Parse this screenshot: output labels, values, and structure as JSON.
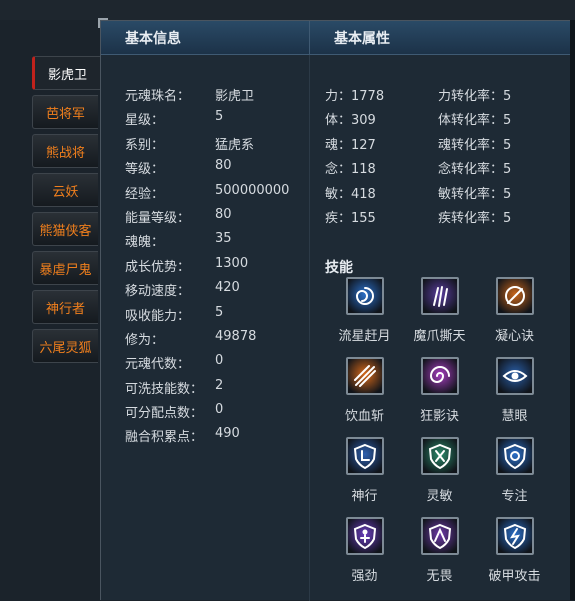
{
  "tabs": [
    "影虎卫",
    "芭将军",
    "熊战将",
    "云妖",
    "熊猫侠客",
    "暴虐尸鬼",
    "神行者",
    "六尾灵狐"
  ],
  "active_tab": 0,
  "headers": {
    "basic_info": "基本信息",
    "basic_attr": "基本属性"
  },
  "info_rows": [
    {
      "k": "元魂珠名：",
      "v": "影虎卫"
    },
    {
      "k": "星级：",
      "v": "5"
    },
    {
      "k": "系别：",
      "v": "猛虎系"
    },
    {
      "k": "等级：",
      "v": "80"
    },
    {
      "k": "经验：",
      "v": "500000000"
    },
    {
      "k": "能量等级：",
      "v": "80"
    },
    {
      "k": "魂魄：",
      "v": "35"
    },
    {
      "k": "成长优势：",
      "v": "1300"
    },
    {
      "k": "移动速度：",
      "v": "420"
    },
    {
      "k": "吸收能力：",
      "v": "5"
    },
    {
      "k": "修为：",
      "v": "49878"
    },
    {
      "k": "元魂代数：",
      "v": "0"
    },
    {
      "k": "可洗技能数：",
      "v": "2"
    },
    {
      "k": "可分配点数：",
      "v": "0"
    },
    {
      "k": "融合积累点：",
      "v": "490"
    }
  ],
  "attributes": [
    {
      "a": "力：1778",
      "b": "力转化率：5"
    },
    {
      "a": "体：309",
      "b": "体转化率：5"
    },
    {
      "a": "魂：127",
      "b": "魂转化率：5"
    },
    {
      "a": "念：118",
      "b": "念转化率：5"
    },
    {
      "a": "敏：418",
      "b": "敏转化率：5"
    },
    {
      "a": "疾：155",
      "b": "疾转化率：5"
    }
  ],
  "skills_title": "技能",
  "skills": [
    {
      "label": "流星赶月",
      "icon": "swirl-icon",
      "color": "#2a6fc9"
    },
    {
      "label": "魔爪撕天",
      "icon": "claw-icon",
      "color": "#5a3d9e"
    },
    {
      "label": "凝心诀",
      "icon": "flame-ring-icon",
      "color": "#c8651a"
    },
    {
      "label": "饮血斩",
      "icon": "slash-icon",
      "color": "#d86a1a"
    },
    {
      "label": "狂影诀",
      "icon": "spiral-icon",
      "color": "#a43dbd"
    },
    {
      "label": "慧眼",
      "icon": "eye-icon",
      "color": "#2a5fa8"
    },
    {
      "label": "神行",
      "icon": "shield-boot-icon",
      "color": "#2e5fae"
    },
    {
      "label": "灵敏",
      "icon": "shield-rune-icon",
      "color": "#2a8a6a"
    },
    {
      "label": "专注",
      "icon": "shield-target-icon",
      "color": "#2a6fc9"
    },
    {
      "label": "强劲",
      "icon": "shield-figure-icon",
      "color": "#6a3dbd"
    },
    {
      "label": "无畏",
      "icon": "shield-warrior-icon",
      "color": "#6e3aa8"
    },
    {
      "label": "破甲攻击",
      "icon": "shield-break-icon",
      "color": "#2a6fc9"
    }
  ]
}
